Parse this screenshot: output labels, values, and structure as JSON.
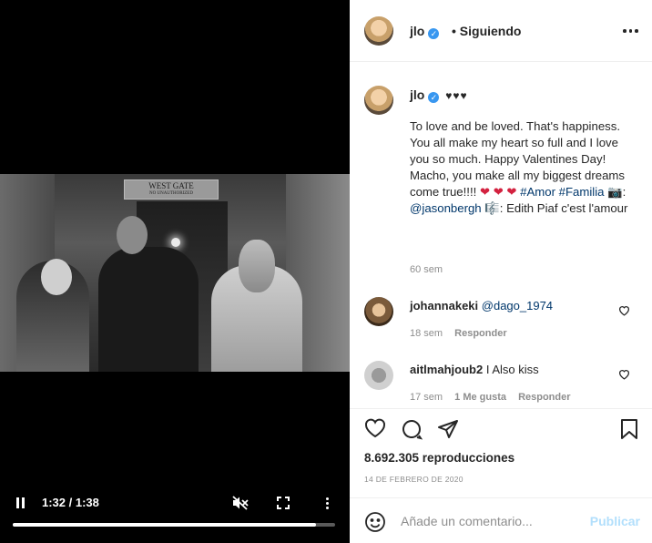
{
  "video": {
    "sign_text": "WEST GATE",
    "sign_subtext": "NO UNAUTHORIZED",
    "time": "1:32 / 1:38",
    "progress": 0.94
  },
  "header": {
    "username": "jlo",
    "separator": "•",
    "follow_status": "Siguiendo"
  },
  "caption": {
    "username": "jlo",
    "hearts": "♥♥♥",
    "text_1": "To love and be loved. That's happiness. You all make my heart so full and I love you so much. Happy Valentines Day! Macho, you make all my biggest dreams come true!!!! ",
    "heart_1": "❤",
    "heart_2": "❤ ❤",
    "hashtag_1": "#Amor",
    "hashtag_2": "#Familia",
    "emoji_camera": "📷",
    "colon_1": ":",
    "mention": "@jasonbergh",
    "emoji_music": "🎼",
    "text_2": ": Edith Piaf c'est l'amour",
    "time": "60 sem"
  },
  "comments": [
    {
      "username": "johannakeki",
      "text": "@dago_1974",
      "time": "18 sem",
      "reply": "Responder"
    },
    {
      "username": "aitlmahjoub2",
      "text": "I Also kiss",
      "time": "17 sem",
      "likes": "1 Me gusta",
      "reply": "Responder"
    }
  ],
  "stats": {
    "views": "8.692.305 reproducciones",
    "date": "14 DE FEBRERO DE 2020"
  },
  "add_comment": {
    "placeholder": "Añade un comentario...",
    "publish": "Publicar"
  },
  "icons": [
    "pause-icon",
    "mute-icon",
    "fullscreen-icon",
    "more-vertical-icon",
    "verified-icon",
    "more-horizontal-icon",
    "heart-icon",
    "comment-icon",
    "share-icon",
    "bookmark-icon",
    "emoji-icon"
  ],
  "colors": {
    "link": "#00376b",
    "verified": "#3897f0",
    "publish_disabled": "#b2dffc",
    "muted_text": "#8e8e8e"
  }
}
